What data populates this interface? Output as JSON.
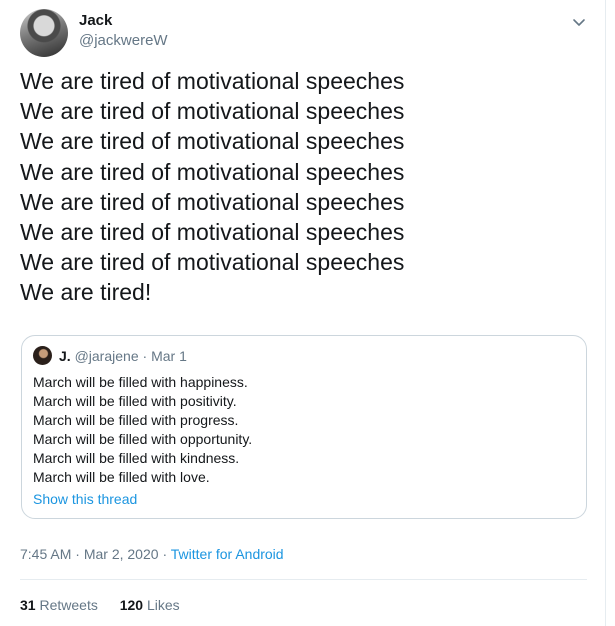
{
  "author": {
    "name": "Jack",
    "handle": "@jackwereW"
  },
  "tweet": {
    "lines": [
      "We are tired of motivational speeches",
      "We are tired of motivational speeches",
      "We are tired of motivational speeches",
      "We are tired of motivational speeches",
      "We are tired of motivational speeches",
      "We are tired of motivational speeches",
      "We are tired of motivational speeches",
      "We are tired!"
    ]
  },
  "quoted": {
    "name": "J.",
    "handle": "@jarajene",
    "separator": "·",
    "date": "Mar 1",
    "lines": [
      "March will be filled with happiness.",
      "March will be filled with positivity.",
      "March will be filled with progress.",
      "March will be filled with opportunity.",
      "March will be filled with kindness.",
      "March will be filled with love."
    ],
    "thread_link": "Show this thread"
  },
  "meta": {
    "time": "7:45 AM",
    "separator": "·",
    "date": "Mar 2, 2020",
    "source": "Twitter for Android"
  },
  "stats": {
    "retweets_count": "31",
    "retweets_label": "Retweets",
    "likes_count": "120",
    "likes_label": "Likes"
  },
  "icons": {
    "menu": "chevron-down-icon"
  },
  "colors": {
    "link": "#1b95e0",
    "secondary_text": "#657786",
    "border": "#ccd6dd"
  }
}
